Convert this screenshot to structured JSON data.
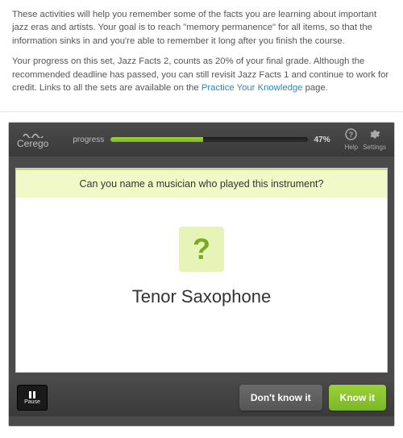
{
  "intro": {
    "p1": "These activities will help you remember some of the facts you are learning about important jazz eras and artists. Your goal is to reach \"memory permanence\" for all items, so that the information sinks in and you're able to remember it long after you finish the course.",
    "p2a": "Your progress on this set, Jazz Facts 2, counts as 20% of your final grade. Although the recommended deadline has passed, you can still revisit Jazz Facts 1 and continue to work for credit. Links to all the sets are available on the ",
    "link_text": "Practice Your Knowledge",
    "p2b": " page."
  },
  "header": {
    "brand": "Cerego",
    "progress_label": "progress",
    "progress_pct": "47%",
    "progress_value": 47,
    "help_label": "Help",
    "settings_label": "Settings"
  },
  "card": {
    "prompt": "Can you name a musician who played this instrument?",
    "question_mark": "?",
    "item": "Tenor Saxophone"
  },
  "footer": {
    "pause_label": "Pause",
    "dont_know_label": "Don't know it",
    "know_label": "Know it"
  }
}
